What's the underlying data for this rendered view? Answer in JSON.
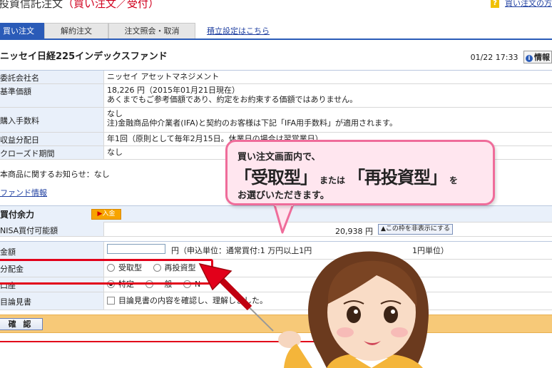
{
  "page_title": {
    "prefix": "投資信託注文",
    "highlight": "（買い注文／受付）"
  },
  "help_link": {
    "icon": "?",
    "text": "買い注文の方"
  },
  "tabs": [
    "買い注文",
    "解約注文",
    "注文照会・取消"
  ],
  "tab_link": "積立設定はこちら",
  "fund": {
    "name": "ニッセイ日経225インデックスファンド",
    "datetime": "01/22 17:33",
    "info_label": "情報"
  },
  "fields": [
    {
      "label": "委託会社名",
      "lines": [
        "ニッセイ アセットマネジメント"
      ]
    },
    {
      "label": "基準価額",
      "lines": [
        "18,226 円（2015年01月21日現在）",
        "あくまでもご参考価額であり、約定をお約束する価額ではありません。"
      ]
    },
    {
      "label": "購入手数料",
      "lines": [
        "なし",
        "注)金融商品仲介業者(IFA)と契約のお客様は下記「IFA用手数料」が適用されます。"
      ]
    },
    {
      "label": "収益分配日",
      "lines": [
        "年1回（原則として毎年2月15日。休業日の場合は翌営業日）"
      ]
    },
    {
      "label": "クローズド期間",
      "lines": [
        "なし"
      ]
    }
  ],
  "notice": "本商品に関するお知らせ：なし",
  "fund_info_link": "ファンド情報",
  "buying_power": {
    "title": "買付余力",
    "deposit_label": "入金",
    "row_label": "NISA買付可能額",
    "amount": "20,938 円",
    "hide_button": "この枠を非表示にする"
  },
  "order": {
    "amount_label": "金額",
    "amount_value": "",
    "amount_note": "円（申込単位：通常買付:1 万円以上1円",
    "amount_note_end": "1円単位）",
    "distribution_label": "分配金",
    "distribution_options": [
      "受取型",
      "再投資型"
    ],
    "account_label": "口座",
    "account_options": [
      "特定",
      "一般",
      "N"
    ],
    "prospectus_label": "目論見書",
    "prospectus_text": "目論見書の内容を確認し、理解しました。",
    "confirm_button": "確 認"
  },
  "callout": {
    "line1": "買い注文画面内で、",
    "option1": "「受取型」",
    "or_text": "または",
    "option2": "「再投資型」",
    "particle": "を",
    "line3": "お選びいただきます。"
  },
  "colors": {
    "tab_active": "#2a5bb8",
    "label_bg": "#e9f0fa",
    "red": "#e2001a",
    "bubble_border": "#ef6c9a",
    "confirm_bar": "#f7c978"
  }
}
